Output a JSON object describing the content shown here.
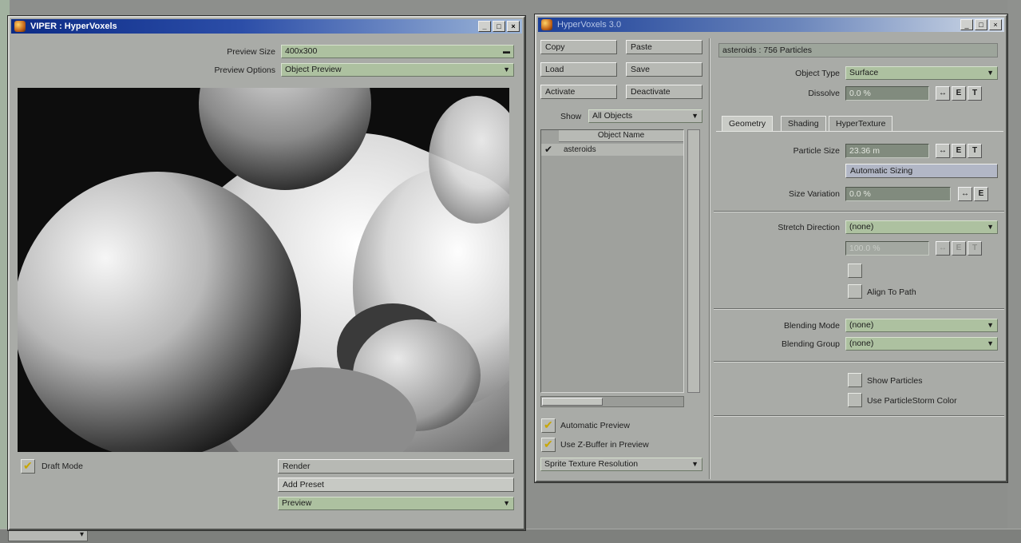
{
  "viper": {
    "title": "VIPER : HyperVoxels",
    "preview_size": {
      "label": "Preview Size",
      "value": "400x300"
    },
    "preview_options": {
      "label": "Preview Options",
      "value": "Object Preview"
    },
    "draft_mode": {
      "label": "Draft Mode",
      "checked": true
    },
    "render_label": "Render",
    "add_preset_label": "Add Preset",
    "preview_dropdown": "Preview"
  },
  "hv": {
    "title": "HyperVoxels 3.0",
    "buttons": {
      "copy": "Copy",
      "paste": "Paste",
      "load": "Load",
      "save": "Save",
      "activate": "Activate",
      "deactivate": "Deactivate"
    },
    "show": {
      "label": "Show",
      "value": "All Objects"
    },
    "list": {
      "header": "Object Name",
      "items": [
        {
          "name": "asteroids",
          "checked": true
        }
      ]
    },
    "automatic_preview": "Automatic Preview",
    "use_zbuffer": "Use Z-Buffer in Preview",
    "sprite_res": "Sprite Texture Resolution",
    "object_info": "asteroids : 756 Particles",
    "object_type": {
      "label": "Object Type",
      "value": "Surface"
    },
    "dissolve": {
      "label": "Dissolve",
      "value": "0.0 %"
    },
    "tabs": [
      "Geometry",
      "Shading",
      "HyperTexture"
    ],
    "particle_size": {
      "label": "Particle Size",
      "value": "23.36 m"
    },
    "automatic_sizing": "Automatic Sizing",
    "size_variation": {
      "label": "Size Variation",
      "value": "0.0 %"
    },
    "stretch_direction": {
      "label": "Stretch Direction",
      "value": "(none)"
    },
    "stretch_amount": {
      "value": "100.0 %"
    },
    "align_to_path": "Align To Path",
    "blending_mode": {
      "label": "Blending Mode",
      "value": "(none)"
    },
    "blending_group": {
      "label": "Blending Group",
      "value": "(none)"
    },
    "show_particles": "Show Particles",
    "use_particlestorm": "Use ParticleStorm Color",
    "env_btn": "E",
    "tex_btn": "T"
  },
  "desktop": {
    "tab_label": ""
  },
  "colors": {
    "titlebar": "#0c2b86",
    "dropdown": "#adc1a0",
    "field": "#818b7e",
    "panel": "#a9aba7"
  }
}
